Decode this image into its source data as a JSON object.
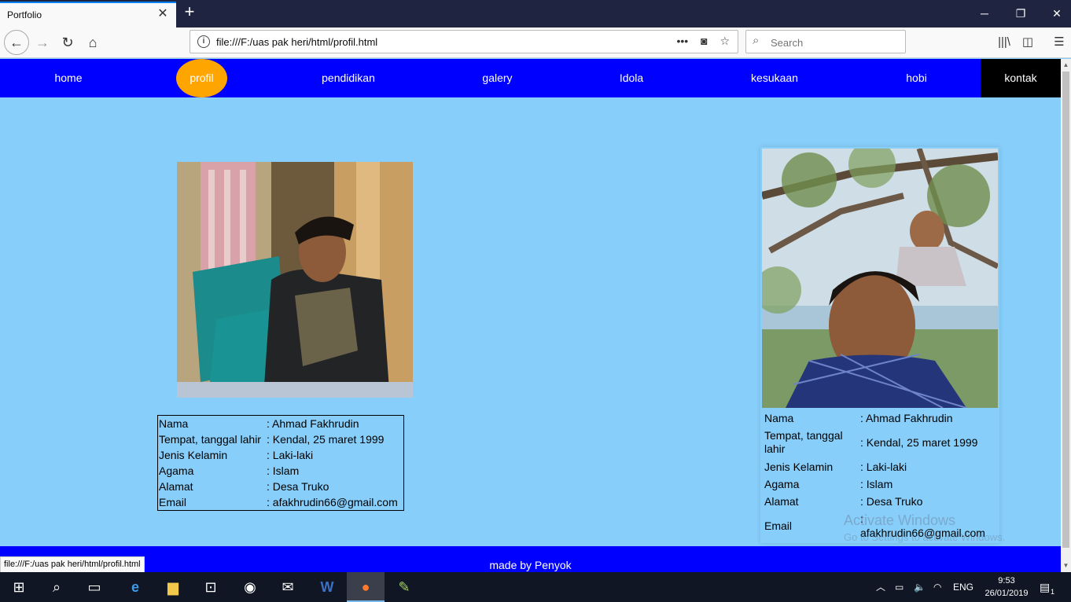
{
  "browser": {
    "tab_title": "Portfolio",
    "tab_close": "✕",
    "new_tab": "+",
    "url": "file:///F:/uas pak heri/html/profil.html",
    "search_placeholder": "Search",
    "status_url": "file:///F:/uas pak heri/html/profil.html"
  },
  "nav": {
    "items": [
      {
        "label": "home"
      },
      {
        "label": "profil"
      },
      {
        "label": "pendidikan"
      },
      {
        "label": "galery"
      },
      {
        "label": "Idola"
      },
      {
        "label": "kesukaan"
      },
      {
        "label": "hobi"
      },
      {
        "label": "kontak"
      }
    ],
    "active_color": "#ffa500",
    "bg_color": "#0000ff"
  },
  "profile_left": {
    "rows": [
      {
        "label": "Nama",
        "value": ": Ahmad Fakhrudin"
      },
      {
        "label": "Tempat, tanggal lahir",
        "value": ": Kendal, 25 maret 1999"
      },
      {
        "label": "Jenis Kelamin",
        "value": ": Laki-laki"
      },
      {
        "label": "Agama",
        "value": ": Islam"
      },
      {
        "label": "Alamat",
        "value": ": Desa Truko"
      },
      {
        "label": "Email",
        "value": ": afakhrudin66@gmail.com"
      }
    ]
  },
  "profile_right": {
    "rows": [
      {
        "label": "Nama",
        "value": ": Ahmad Fakhrudin"
      },
      {
        "label": "Tempat, tanggal lahir",
        "value": ": Kendal, 25 maret 1999"
      },
      {
        "label": "Jenis Kelamin",
        "value": ": Laki-laki"
      },
      {
        "label": "Agama",
        "value": ": Islam"
      },
      {
        "label": "Alamat",
        "value": ": Desa Truko"
      },
      {
        "label": "Email",
        "value": ":",
        "value2": "afakhrudin66@gmail.com"
      }
    ]
  },
  "watermark": {
    "title": "Activate Windows",
    "subtitle": "Go to Settings to activate Windows."
  },
  "footer": {
    "text": "made by Penyok"
  },
  "taskbar": {
    "language": "ENG",
    "time": "9:53",
    "date": "26/01/2019",
    "notification_count": "1"
  }
}
